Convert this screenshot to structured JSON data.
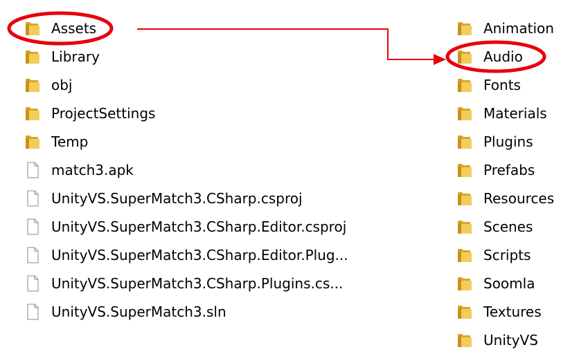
{
  "left_list": [
    {
      "label": "Assets",
      "icon": "folder-icon",
      "type": "folder"
    },
    {
      "label": "Library",
      "icon": "folder-icon",
      "type": "folder"
    },
    {
      "label": "obj",
      "icon": "folder-icon",
      "type": "folder"
    },
    {
      "label": "ProjectSettings",
      "icon": "folder-icon",
      "type": "folder"
    },
    {
      "label": "Temp",
      "icon": "folder-icon",
      "type": "folder"
    },
    {
      "label": "match3.apk",
      "icon": "file-icon",
      "type": "file"
    },
    {
      "label": "UnityVS.SuperMatch3.CSharp.csproj",
      "icon": "file-icon",
      "type": "file"
    },
    {
      "label": "UnityVS.SuperMatch3.CSharp.Editor.csproj",
      "icon": "file-icon",
      "type": "file"
    },
    {
      "label": "UnityVS.SuperMatch3.CSharp.Editor.Plug...",
      "icon": "file-icon",
      "type": "file"
    },
    {
      "label": "UnityVS.SuperMatch3.CSharp.Plugins.cs...",
      "icon": "file-icon",
      "type": "file"
    },
    {
      "label": "UnityVS.SuperMatch3.sln",
      "icon": "file-icon",
      "type": "file"
    }
  ],
  "right_list": [
    {
      "label": "Animation",
      "icon": "folder-icon",
      "type": "folder"
    },
    {
      "label": "Audio",
      "icon": "folder-icon",
      "type": "folder"
    },
    {
      "label": "Fonts",
      "icon": "folder-icon",
      "type": "folder"
    },
    {
      "label": "Materials",
      "icon": "folder-icon",
      "type": "folder"
    },
    {
      "label": "Plugins",
      "icon": "folder-icon",
      "type": "folder"
    },
    {
      "label": "Prefabs",
      "icon": "folder-icon",
      "type": "folder"
    },
    {
      "label": "Resources",
      "icon": "folder-icon",
      "type": "folder"
    },
    {
      "label": "Scenes",
      "icon": "folder-icon",
      "type": "folder"
    },
    {
      "label": "Scripts",
      "icon": "folder-icon",
      "type": "folder"
    },
    {
      "label": "Soomla",
      "icon": "folder-icon",
      "type": "folder"
    },
    {
      "label": "Textures",
      "icon": "folder-icon",
      "type": "folder"
    },
    {
      "label": "UnityVS",
      "icon": "folder-icon",
      "type": "folder"
    }
  ],
  "annotations": {
    "color": "#e8000b",
    "highlighted": [
      "Assets",
      "Audio"
    ],
    "arrow": "from Assets to Audio"
  },
  "colors": {
    "folder_body": "#f2cd5c",
    "folder_back": "#d9a62a",
    "folder_shade": "#c9901a",
    "file_fill": "#ffffff",
    "file_stroke": "#8a8a8a"
  }
}
